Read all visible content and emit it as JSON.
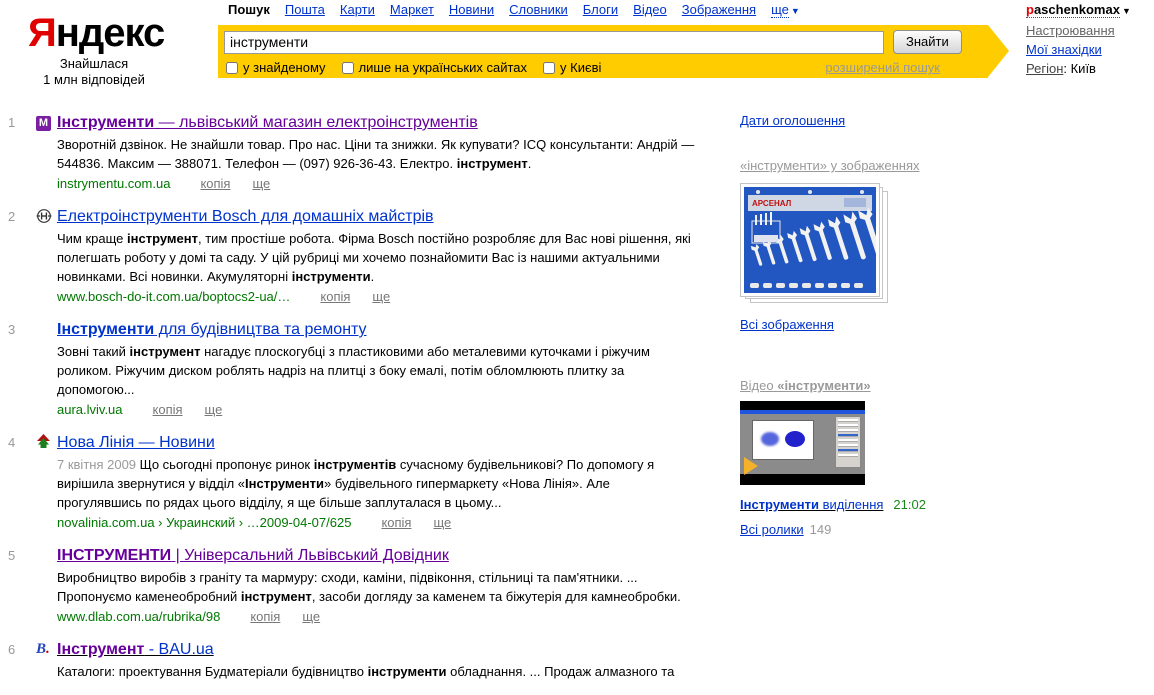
{
  "colors": {
    "accent_yellow": "#ffcc00",
    "link_blue": "#0033cc",
    "visited_purple": "#660099",
    "url_green": "#007700",
    "logo_red": "#e00000"
  },
  "header": {
    "logo_first": "Я",
    "logo_rest": "ндекс",
    "stats_line1": "Знайшлася",
    "stats_line2": "1 млн відповідей",
    "nav": [
      "Пошук",
      "Пошта",
      "Карти",
      "Маркет",
      "Новини",
      "Словники",
      "Блоги",
      "Відео",
      "Зображення"
    ],
    "nav_more": "ще",
    "search": {
      "value": "інструменти",
      "button": "Знайти",
      "checkboxes": [
        "у знайденому",
        "лише на українських сайтах",
        "у Києві"
      ],
      "advanced": "розширений пошук"
    },
    "user": {
      "name_segments": [
        {
          "t": "p",
          "c": "red"
        },
        {
          "t": "aschenkomax"
        }
      ],
      "settings": "Настроювання",
      "finds": "Мої знахідки",
      "region_label": "Регіон",
      "region_value": "Київ"
    }
  },
  "results": [
    {
      "num": "1",
      "favicon_text": "M",
      "title_segments": [
        {
          "t": "Інструменти",
          "b": true
        },
        {
          "t": " — львівський магазин електроінструментів"
        }
      ],
      "desc_segments": [
        {
          "t": "Зворотній дзвінок. Не знайшли товар. Про нас. Ціни та знижки. Як купувати? ICQ консультанти: Андрій — 544836. Максим — 388071. Телефон — (097) 926-36-43. Електро. "
        },
        {
          "t": "інструмент",
          "b": true
        },
        {
          "t": "."
        }
      ],
      "url": "instrymentu.com.ua",
      "links": [
        "копія",
        "ще"
      ]
    },
    {
      "num": "2",
      "title_segments": [
        {
          "t": "Електроінструменти Bosch для домашніх майстрів"
        }
      ],
      "desc_segments": [
        {
          "t": "Чим краще "
        },
        {
          "t": "інструмент",
          "b": true
        },
        {
          "t": ", тим простіше робота. Фірма Bosch постійно розробляє для Вас нові рішення, які полегшать роботу у домі та саду. У цій рубриці ми хочемо познайомити Вас із нашими актуальними новинками. Всі новинки. Акумуляторні "
        },
        {
          "t": "інструменти",
          "b": true
        },
        {
          "t": "."
        }
      ],
      "url": "www.bosch-do-it.com.ua/boptocs2-ua/…",
      "links": [
        "копія",
        "ще"
      ]
    },
    {
      "num": "3",
      "title_segments": [
        {
          "t": "Інструменти",
          "b": true
        },
        {
          "t": " для будівництва та ремонту"
        }
      ],
      "desc_segments": [
        {
          "t": "Зовні такий "
        },
        {
          "t": "інструмент",
          "b": true
        },
        {
          "t": " нагадує плоскогубці з пластиковими або металевими куточками і ріжучим роликом. Ріжучим диском роблять надріз на плитці з боку емалі, потім обломлюють плитку за допомогою..."
        }
      ],
      "url": "aura.lviv.ua",
      "links": [
        "копія",
        "ще"
      ]
    },
    {
      "num": "4",
      "title_segments": [
        {
          "t": "Нова Лінія — Новини"
        }
      ],
      "desc_segments": [
        {
          "t": "7 квітня 2009 ",
          "c": "gray"
        },
        {
          "t": "Що сьогодні пропонує ринок "
        },
        {
          "t": "інструментів",
          "b": true
        },
        {
          "t": " сучасному будівельникові? По допомогу я вирішила звернутися у відділ «"
        },
        {
          "t": "Інструменти",
          "b": true
        },
        {
          "t": "» будівельного гипермаркету «Нова Лінія». Але прогулявшись по рядах цього відділу, я ще більше заплуталася в цьому..."
        }
      ],
      "url": "novalinia.com.ua › Украинский › …2009-04-07/625",
      "links": [
        "копія",
        "ще"
      ]
    },
    {
      "num": "5",
      "title_segments": [
        {
          "t": "ІНСТРУМЕНТИ",
          "b": true
        },
        {
          "t": " | Універсальний Львівський Довідник"
        }
      ],
      "desc_segments": [
        {
          "t": "Виробництво виробів з граніту та мармуру: сходи, каміни, підвіконня, стільниці та пам'ятники. ... Пропонуємо каменеобробний "
        },
        {
          "t": "інструмент",
          "b": true
        },
        {
          "t": ", засоби догляду за каменем та біжутерія для камнеобробки."
        }
      ],
      "url": "www.dlab.com.ua/rubrika/98",
      "links": [
        "копія",
        "ще"
      ]
    },
    {
      "num": "6",
      "favicon_segments": [
        {
          "t": "B",
          "c": "bau-b"
        },
        {
          "t": ".",
          "c": "bau-dot"
        }
      ],
      "title_segments": [
        {
          "t": "Інструмент",
          "b": true,
          "c": "visited"
        },
        {
          "t": " - BAU.ua",
          "c": "blue"
        }
      ],
      "desc_segments": [
        {
          "t": "Каталоги: проектування Будматеріали будівництво "
        },
        {
          "t": "інструменти",
          "b": true
        },
        {
          "t": " обладнання. ... Продаж алмазного та"
        }
      ],
      "url": "",
      "links": []
    }
  ],
  "sidebar": {
    "dates_link": "Дати оголошення",
    "images_header": "«інструменти» у зображеннях",
    "image_brand": "АРСЕНАЛ",
    "all_images": "Всі зображення",
    "video_header_segments": [
      {
        "t": "Відео "
      },
      {
        "t": "«інструменти»",
        "b": true
      }
    ],
    "video_title_segments": [
      {
        "t": "Інструменти",
        "c": "b1"
      },
      {
        "t": " виділення",
        "c": "b2"
      }
    ],
    "video_time": "21:02",
    "all_videos": "Всі ролики",
    "videos_count": "149"
  }
}
